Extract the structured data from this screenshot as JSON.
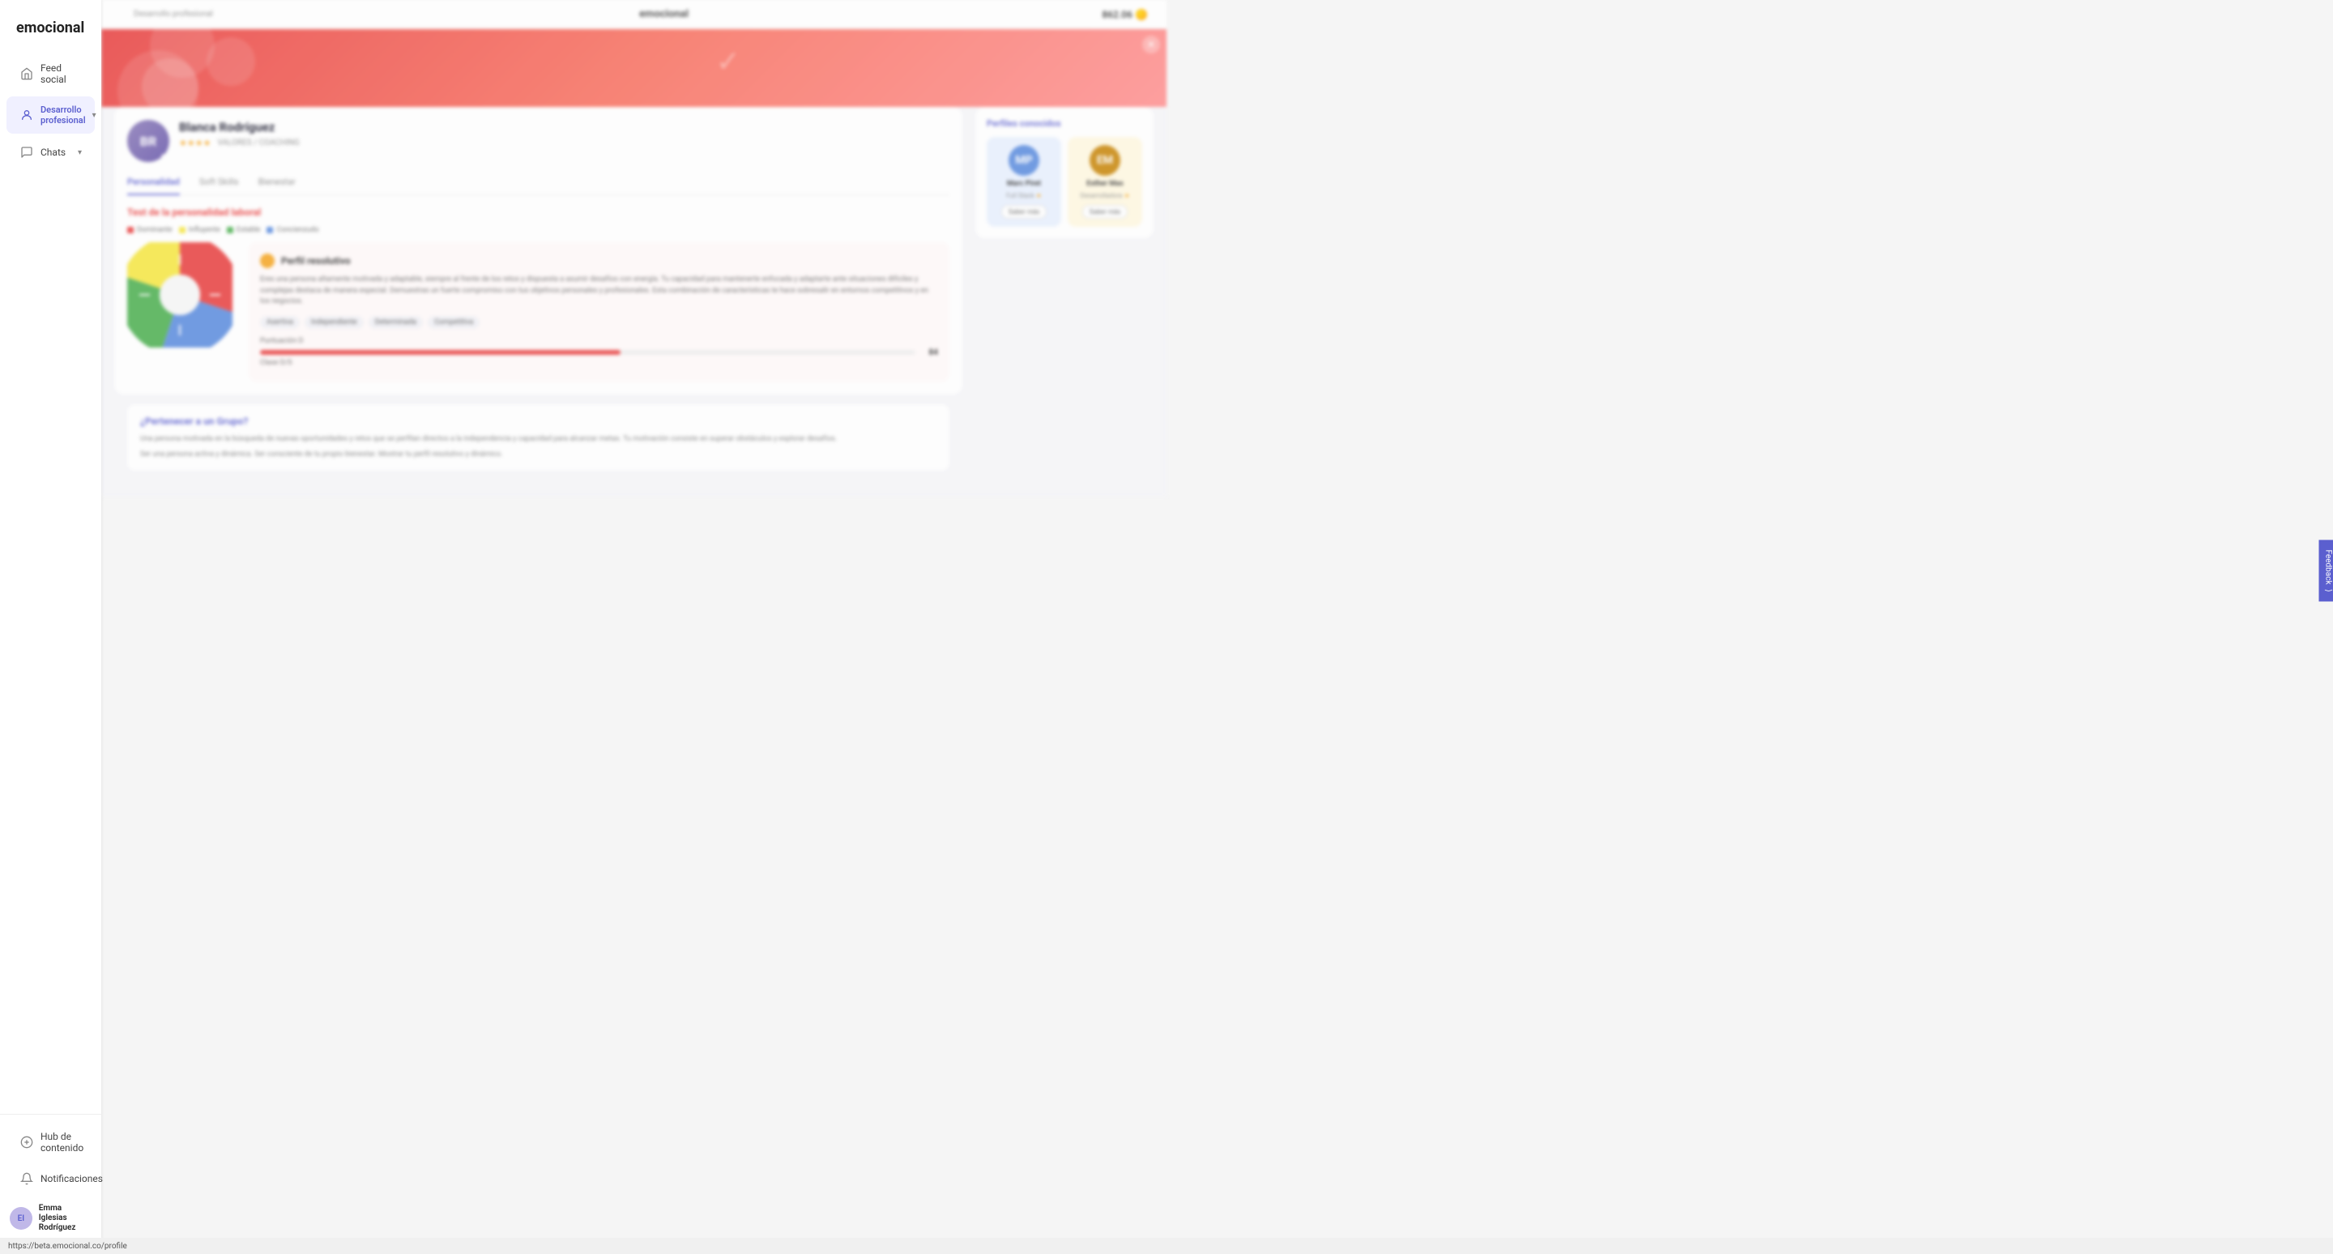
{
  "app": {
    "title": "emocional",
    "url": "https://beta.emocional.co/profile"
  },
  "header": {
    "breadcrumb": "Desarrollo profesional",
    "brand": "emocional",
    "coins_label": "862.06",
    "coins_icon": "coin-icon"
  },
  "sidebar": {
    "logo": "emocional",
    "items": [
      {
        "id": "feed-social",
        "label": "Feed social",
        "icon": "home-icon",
        "active": false
      },
      {
        "id": "desarrollo-profesional",
        "label": "Desarrollo profesional",
        "icon": "user-circle-icon",
        "active": true,
        "has_chevron": true
      },
      {
        "id": "chats",
        "label": "Chats",
        "icon": "chat-icon",
        "active": false,
        "has_chevron": true
      }
    ],
    "bottom_items": [
      {
        "id": "hub-de-contenido",
        "label": "Hub de contenido",
        "icon": "content-icon"
      },
      {
        "id": "notificaciones",
        "label": "Notificaciones",
        "icon": "bell-icon"
      }
    ],
    "user": {
      "name_line1": "Emma Iglesias",
      "name_line2": "Rodríguez",
      "avatar_initials": "EI"
    }
  },
  "profile": {
    "name": "Blanca Rodríguez",
    "stars": "★★★★",
    "meta": "VALORES / COACHING",
    "online_status": "online"
  },
  "tabs": [
    {
      "id": "personalidad",
      "label": "Personalidad",
      "active": true
    },
    {
      "id": "soft-skills",
      "label": "Soft Skills",
      "active": false
    },
    {
      "id": "bienestar",
      "label": "Bienestar",
      "active": false
    }
  ],
  "personality": {
    "section_title": "Test de la personalidad laboral",
    "legend": [
      {
        "color": "#e84040",
        "label": "Dominante"
      },
      {
        "color": "#f5e642",
        "label": "Influyente"
      },
      {
        "color": "#4caf50",
        "label": "Estable"
      },
      {
        "color": "#5b8cde",
        "label": "Concienzudo"
      }
    ],
    "chart": {
      "segments": [
        {
          "color": "#e84040",
          "pct": 30
        },
        {
          "color": "#5b8cde",
          "pct": 25
        },
        {
          "color": "#4caf50",
          "pct": 25
        },
        {
          "color": "#f5e642",
          "pct": 20
        }
      ]
    },
    "profile_card": {
      "dot_color": "#f5a623",
      "title": "Perfil resolutivo",
      "description": "Eres una persona altamente motivada y adaptable, siempre al frente de los retos y dispuesta a asumir desafíos con energía. Tu capacidad para mantenerte enfocada y adaptarte ante situaciones difíciles y complejas destaca de manera especial. Demuestras un fuerte compromiso con tus objetivos personales y profesionales. Esta combinación de características te hace sobresalir en entornos competitivos y en los negocios.",
      "tags": [
        "Asertiva",
        "Independiente",
        "Determinada",
        "Competitiva"
      ],
      "progress_label": "Puntuación D",
      "progress_note": "Clase D/S",
      "progress_value": "84",
      "progress_pct": 55
    }
  },
  "right_sidebar": {
    "perfiles_title": "Perfiles",
    "perfiles_title_colored": "conocidos",
    "profiles": [
      {
        "id": "marc-piret",
        "name": "Marc Piret",
        "role": "Full Stack",
        "compat_pct": "",
        "card_color": "blue",
        "avatar_color": "blue-av",
        "avatar_initials": "MP",
        "button_label": "Saber más"
      },
      {
        "id": "esther-mas",
        "name": "Esther Mas",
        "role": "Desarrolladora",
        "compat_pct": "",
        "card_color": "yellow",
        "avatar_color": "yellow-av",
        "avatar_initials": "EM",
        "button_label": "Saber más"
      }
    ]
  },
  "feedback": {
    "label": "Feedback"
  },
  "extra_section": {
    "title": "¿Pertenecer a un Grupo?",
    "text": "Una persona motivada en la búsqueda de nuevas oportunidades y retos que se perfilan directos a la independencia y capacidad para alcanzar metas. Tu motivación consiste en superar obstáculos y explorar desafíos.",
    "more_text": "Ser una persona activa y dinámica. Ser consciente de tu propio bienestar. Mostrar tu perfil resolutivo y dinámico."
  }
}
